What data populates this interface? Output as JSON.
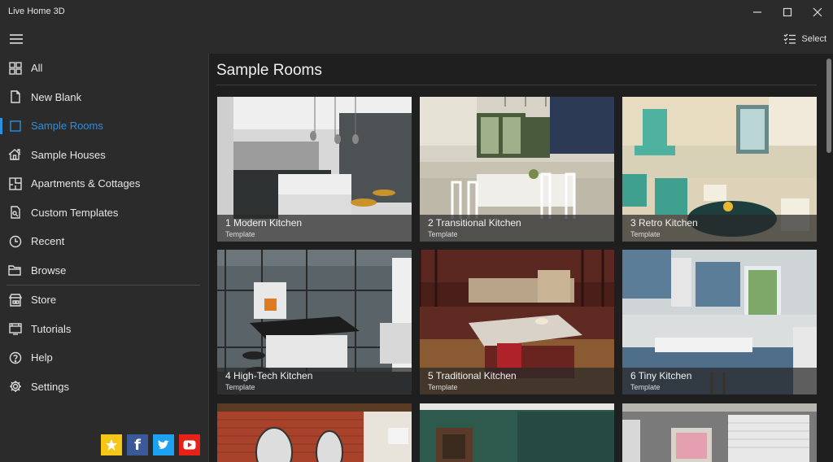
{
  "window": {
    "title": "Live Home 3D"
  },
  "toolbar": {
    "select_label": "Select"
  },
  "sidebar": {
    "items": [
      {
        "label": "All",
        "icon": "grid-icon"
      },
      {
        "label": "New Blank",
        "icon": "blank-document-icon"
      },
      {
        "label": "Sample Rooms",
        "icon": "room-square-icon",
        "active": true
      },
      {
        "label": "Sample Houses",
        "icon": "house-icon"
      },
      {
        "label": "Apartments & Cottages",
        "icon": "floorplan-icon"
      },
      {
        "label": "Custom Templates",
        "icon": "template-doc-icon"
      },
      {
        "label": "Recent",
        "icon": "clock-icon"
      },
      {
        "label": "Browse",
        "icon": "folder-icon"
      }
    ],
    "secondary": [
      {
        "label": "Store",
        "icon": "store-icon"
      },
      {
        "label": "Tutorials",
        "icon": "tutorials-icon"
      },
      {
        "label": "Help",
        "icon": "help-icon"
      },
      {
        "label": "Settings",
        "icon": "gear-icon"
      }
    ],
    "social": [
      "star-rate-icon",
      "facebook-icon",
      "twitter-icon",
      "youtube-icon"
    ]
  },
  "main": {
    "title": "Sample Rooms",
    "cards": [
      {
        "title": "1 Modern Kitchen",
        "subtitle": "Template"
      },
      {
        "title": "2 Transitional Kitchen",
        "subtitle": "Template"
      },
      {
        "title": "3 Retro Kitchen",
        "subtitle": "Template"
      },
      {
        "title": "4 High-Tech Kitchen",
        "subtitle": "Template"
      },
      {
        "title": "5 Traditional Kitchen",
        "subtitle": "Template"
      },
      {
        "title": "6 Tiny Kitchen",
        "subtitle": "Template"
      }
    ]
  },
  "colors": {
    "accent": "#2d8fe0",
    "background": "#1f1f1f",
    "chrome": "#2b2b2b",
    "star": "#f5c518",
    "facebook": "#3b5998",
    "twitter": "#1da1f2",
    "youtube": "#e62117"
  }
}
